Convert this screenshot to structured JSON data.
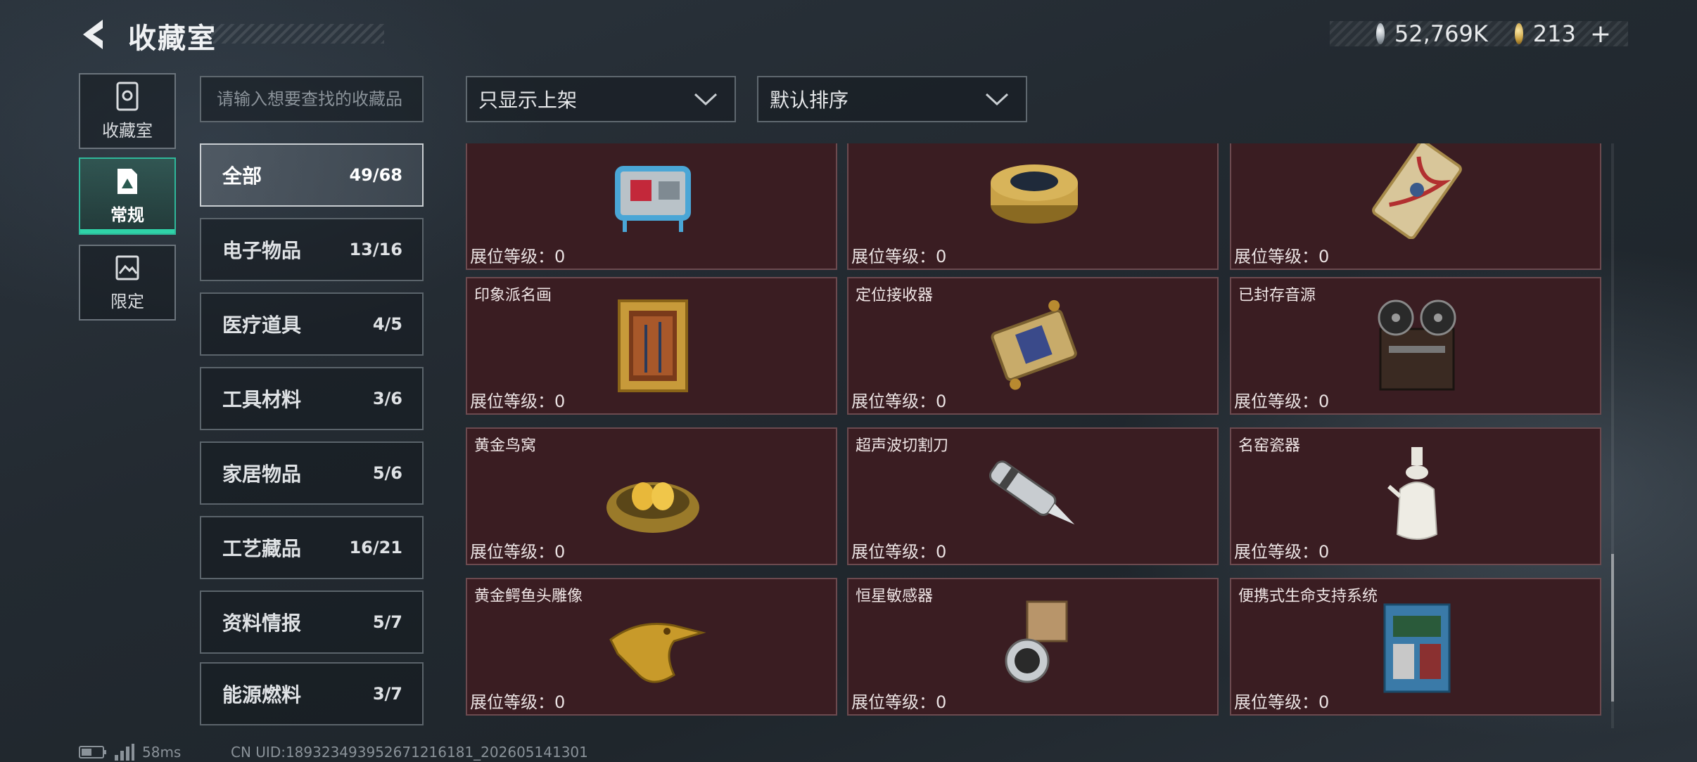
{
  "header": {
    "title": "收藏室"
  },
  "currency": {
    "silver": "52,769K",
    "gold": "213",
    "gold_plus": "+"
  },
  "rail": {
    "items": [
      {
        "label": "收藏室"
      },
      {
        "label": "常规"
      },
      {
        "label": "限定"
      }
    ]
  },
  "search": {
    "placeholder": "请输入想要查找的收藏品"
  },
  "filters": {
    "shelf_filter": "只显示上架",
    "sort": "默认排序"
  },
  "categories": [
    {
      "name": "全部",
      "count": "49/68"
    },
    {
      "name": "电子物品",
      "count": "13/16"
    },
    {
      "name": "医疗道具",
      "count": "4/5"
    },
    {
      "name": "工具材料",
      "count": "3/6"
    },
    {
      "name": "家居物品",
      "count": "5/6"
    },
    {
      "name": "工艺藏品",
      "count": "16/21"
    },
    {
      "name": "资料情报",
      "count": "5/7"
    },
    {
      "name": "能源燃料",
      "count": "3/7"
    }
  ],
  "level_label": "展位等级：",
  "cards": [
    {
      "name": "",
      "level": "0",
      "icon": "generator-icon"
    },
    {
      "name": "",
      "level": "0",
      "icon": "caviar-tin-icon"
    },
    {
      "name": "",
      "level": "0",
      "icon": "ornate-card-icon"
    },
    {
      "name": "印象派名画",
      "level": "0",
      "icon": "framed-painting-icon"
    },
    {
      "name": "定位接收器",
      "level": "0",
      "icon": "receiver-icon"
    },
    {
      "name": "已封存音源",
      "level": "0",
      "icon": "reel-tape-icon"
    },
    {
      "name": "黄金鸟窝",
      "level": "0",
      "icon": "golden-nest-icon"
    },
    {
      "name": "超声波切割刀",
      "level": "0",
      "icon": "cutter-icon"
    },
    {
      "name": "名窑瓷器",
      "level": "0",
      "icon": "porcelain-vase-icon"
    },
    {
      "name": "黄金鳄鱼头雕像",
      "level": "0",
      "icon": "croc-statue-icon"
    },
    {
      "name": "恒星敏感器",
      "level": "0",
      "icon": "star-sensor-icon"
    },
    {
      "name": "便携式生命支持系统",
      "level": "0",
      "icon": "life-support-icon"
    }
  ],
  "footer": {
    "ping": "58ms",
    "uid": "CN UID:18932349395267121618​1_202605141301"
  }
}
